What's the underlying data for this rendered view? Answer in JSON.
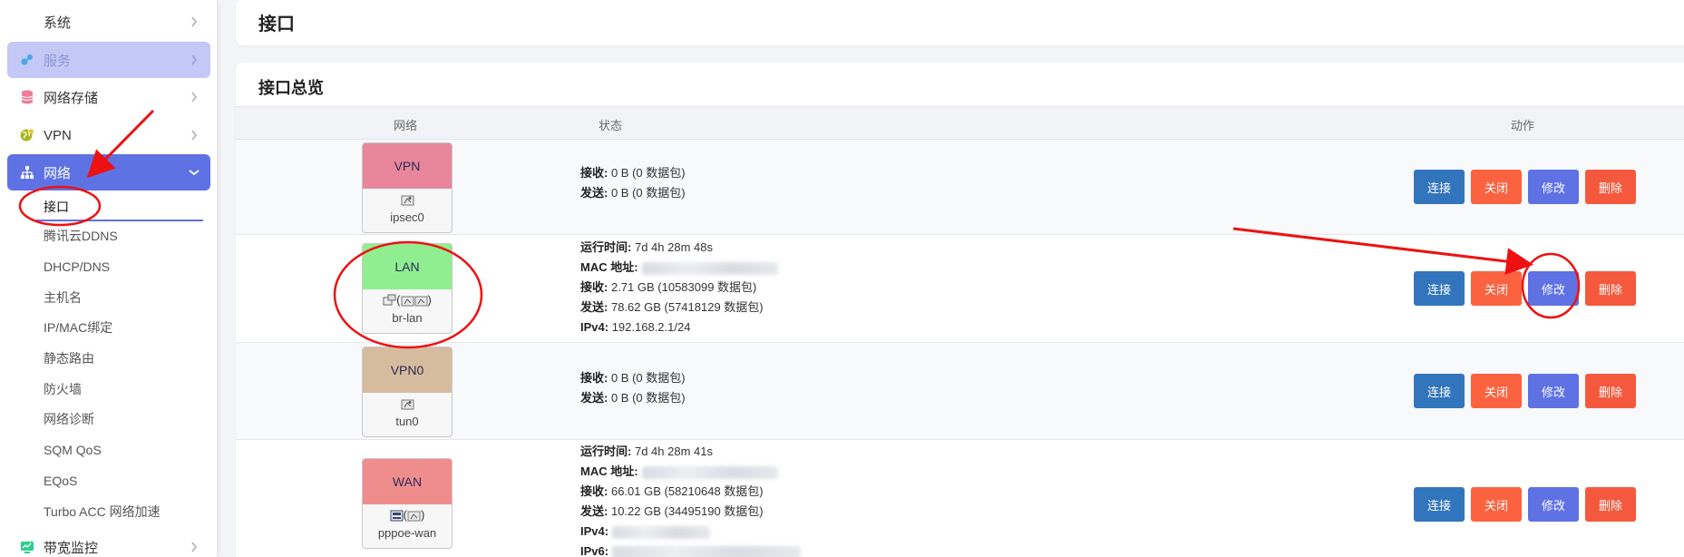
{
  "sidebar": {
    "items": [
      {
        "label": "系统",
        "icon": "gear-icon"
      },
      {
        "label": "服务",
        "icon": "services-icon"
      },
      {
        "label": "网络存储",
        "icon": "database-icon"
      },
      {
        "label": "VPN",
        "icon": "vpn-globe-icon"
      },
      {
        "label": "网络",
        "icon": "network-tree-icon"
      }
    ],
    "network_submenu": [
      "接口",
      "腾讯云DDNS",
      "DHCP/DNS",
      "主机名",
      "IP/MAC绑定",
      "静态路由",
      "防火墙",
      "网络诊断",
      "SQM QoS",
      "EQoS",
      "Turbo ACC 网络加速"
    ],
    "bandwidth": {
      "label": "带宽监控",
      "icon": "monitor-icon"
    }
  },
  "header": {
    "title": "接口"
  },
  "overview": {
    "title": "接口总览",
    "columns": {
      "network": "网络",
      "status": "状态",
      "actions": "动作"
    },
    "labels": {
      "uptime": "运行时间:",
      "mac": "MAC 地址:",
      "rx": "接收:",
      "tx": "发送:",
      "ipv4": "IPv4:",
      "ipv6": "IPv6:"
    },
    "buttons": {
      "connect": "连接",
      "stop": "关闭",
      "edit": "修改",
      "delete": "删除"
    },
    "interfaces": [
      {
        "name": "VPN",
        "device": "ipsec0",
        "color": "#e8879b",
        "rx": "0 B (0 数据包)",
        "tx": "0 B (0 数据包)"
      },
      {
        "name": "LAN",
        "device": "br-lan",
        "color": "#90ee90",
        "icons_text": "(",
        "icons_text_end": ")",
        "uptime": "7d 4h 28m 48s",
        "rx": "2.71 GB (10583099 数据包)",
        "tx": "78.62 GB (57418129 数据包)",
        "ipv4": "192.168.2.1/24"
      },
      {
        "name": "VPN0",
        "device": "tun0",
        "color": "#d6bc9e",
        "rx": "0 B (0 数据包)",
        "tx": "0 B (0 数据包)"
      },
      {
        "name": "WAN",
        "device": "pppoe-wan",
        "color": "#ef8d8d",
        "icons_text": "(",
        "icons_text_end": ")",
        "uptime": "7d 4h 28m 41s",
        "rx": "66.01 GB (58210648 数据包)",
        "tx": "10.22 GB (34495190 数据包)"
      }
    ]
  },
  "colors": {
    "accent": "#5e72e4",
    "connect": "#3275bd",
    "stop": "#fb6340",
    "delete": "#f5593d",
    "annotation": "#ee1111"
  }
}
